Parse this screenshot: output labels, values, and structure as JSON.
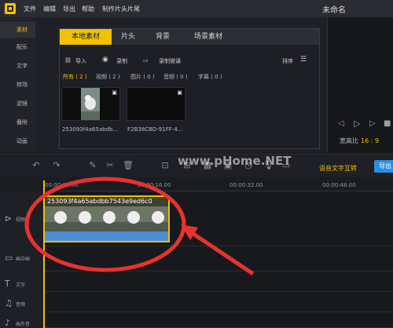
{
  "menu": {
    "items": [
      "文件",
      "编辑",
      "导出",
      "帮助",
      "制作片头片尾"
    ],
    "doc_title": "未命名"
  },
  "sidebar": {
    "items": [
      "素材",
      "配乐",
      "文字",
      "转场",
      "滤镜",
      "叠附",
      "动画"
    ],
    "active": 0
  },
  "panel": {
    "tabs": [
      "本地素材",
      "片头",
      "背景",
      "场景素材"
    ],
    "active_tab": 0,
    "tools": {
      "import": "导入",
      "record": "录制",
      "record_course": "录制微课",
      "sort": "排序"
    },
    "filters": [
      "所有 ( 2 )",
      "视频 ( 2 )",
      "图片 ( 0 )",
      "音频 ( 0 )",
      "字幕 ( 0 )"
    ],
    "thumbnails": [
      {
        "name": "253093f4a65abdb..."
      },
      {
        "name": "F2B38CBD-91FF-4..."
      }
    ]
  },
  "preview": {
    "ratio_label": "宽高比",
    "ratio_value": "16 : 9"
  },
  "toolbar": {
    "voice_text": "语音文字互转",
    "export": "导出"
  },
  "ruler": {
    "ticks": [
      "00:00:00.00",
      "00:00:16.00",
      "00:00:32.00",
      "00:00:48.00"
    ]
  },
  "tracks": [
    {
      "label": "视频",
      "icon": "video-icon"
    },
    {
      "label": "画中画",
      "icon": "pip-icon"
    },
    {
      "label": "文字",
      "icon": "text-icon"
    },
    {
      "label": "音频",
      "icon": "music-icon"
    },
    {
      "label": "画外音",
      "icon": "voiceover-icon"
    }
  ],
  "clip": {
    "title": "253093f4a65abdbb7543e9ed6c0"
  },
  "watermark": "www.pHome.NET",
  "colors": {
    "accent": "#f0c000",
    "export": "#2a8ee6",
    "annotation": "#e8322e"
  }
}
